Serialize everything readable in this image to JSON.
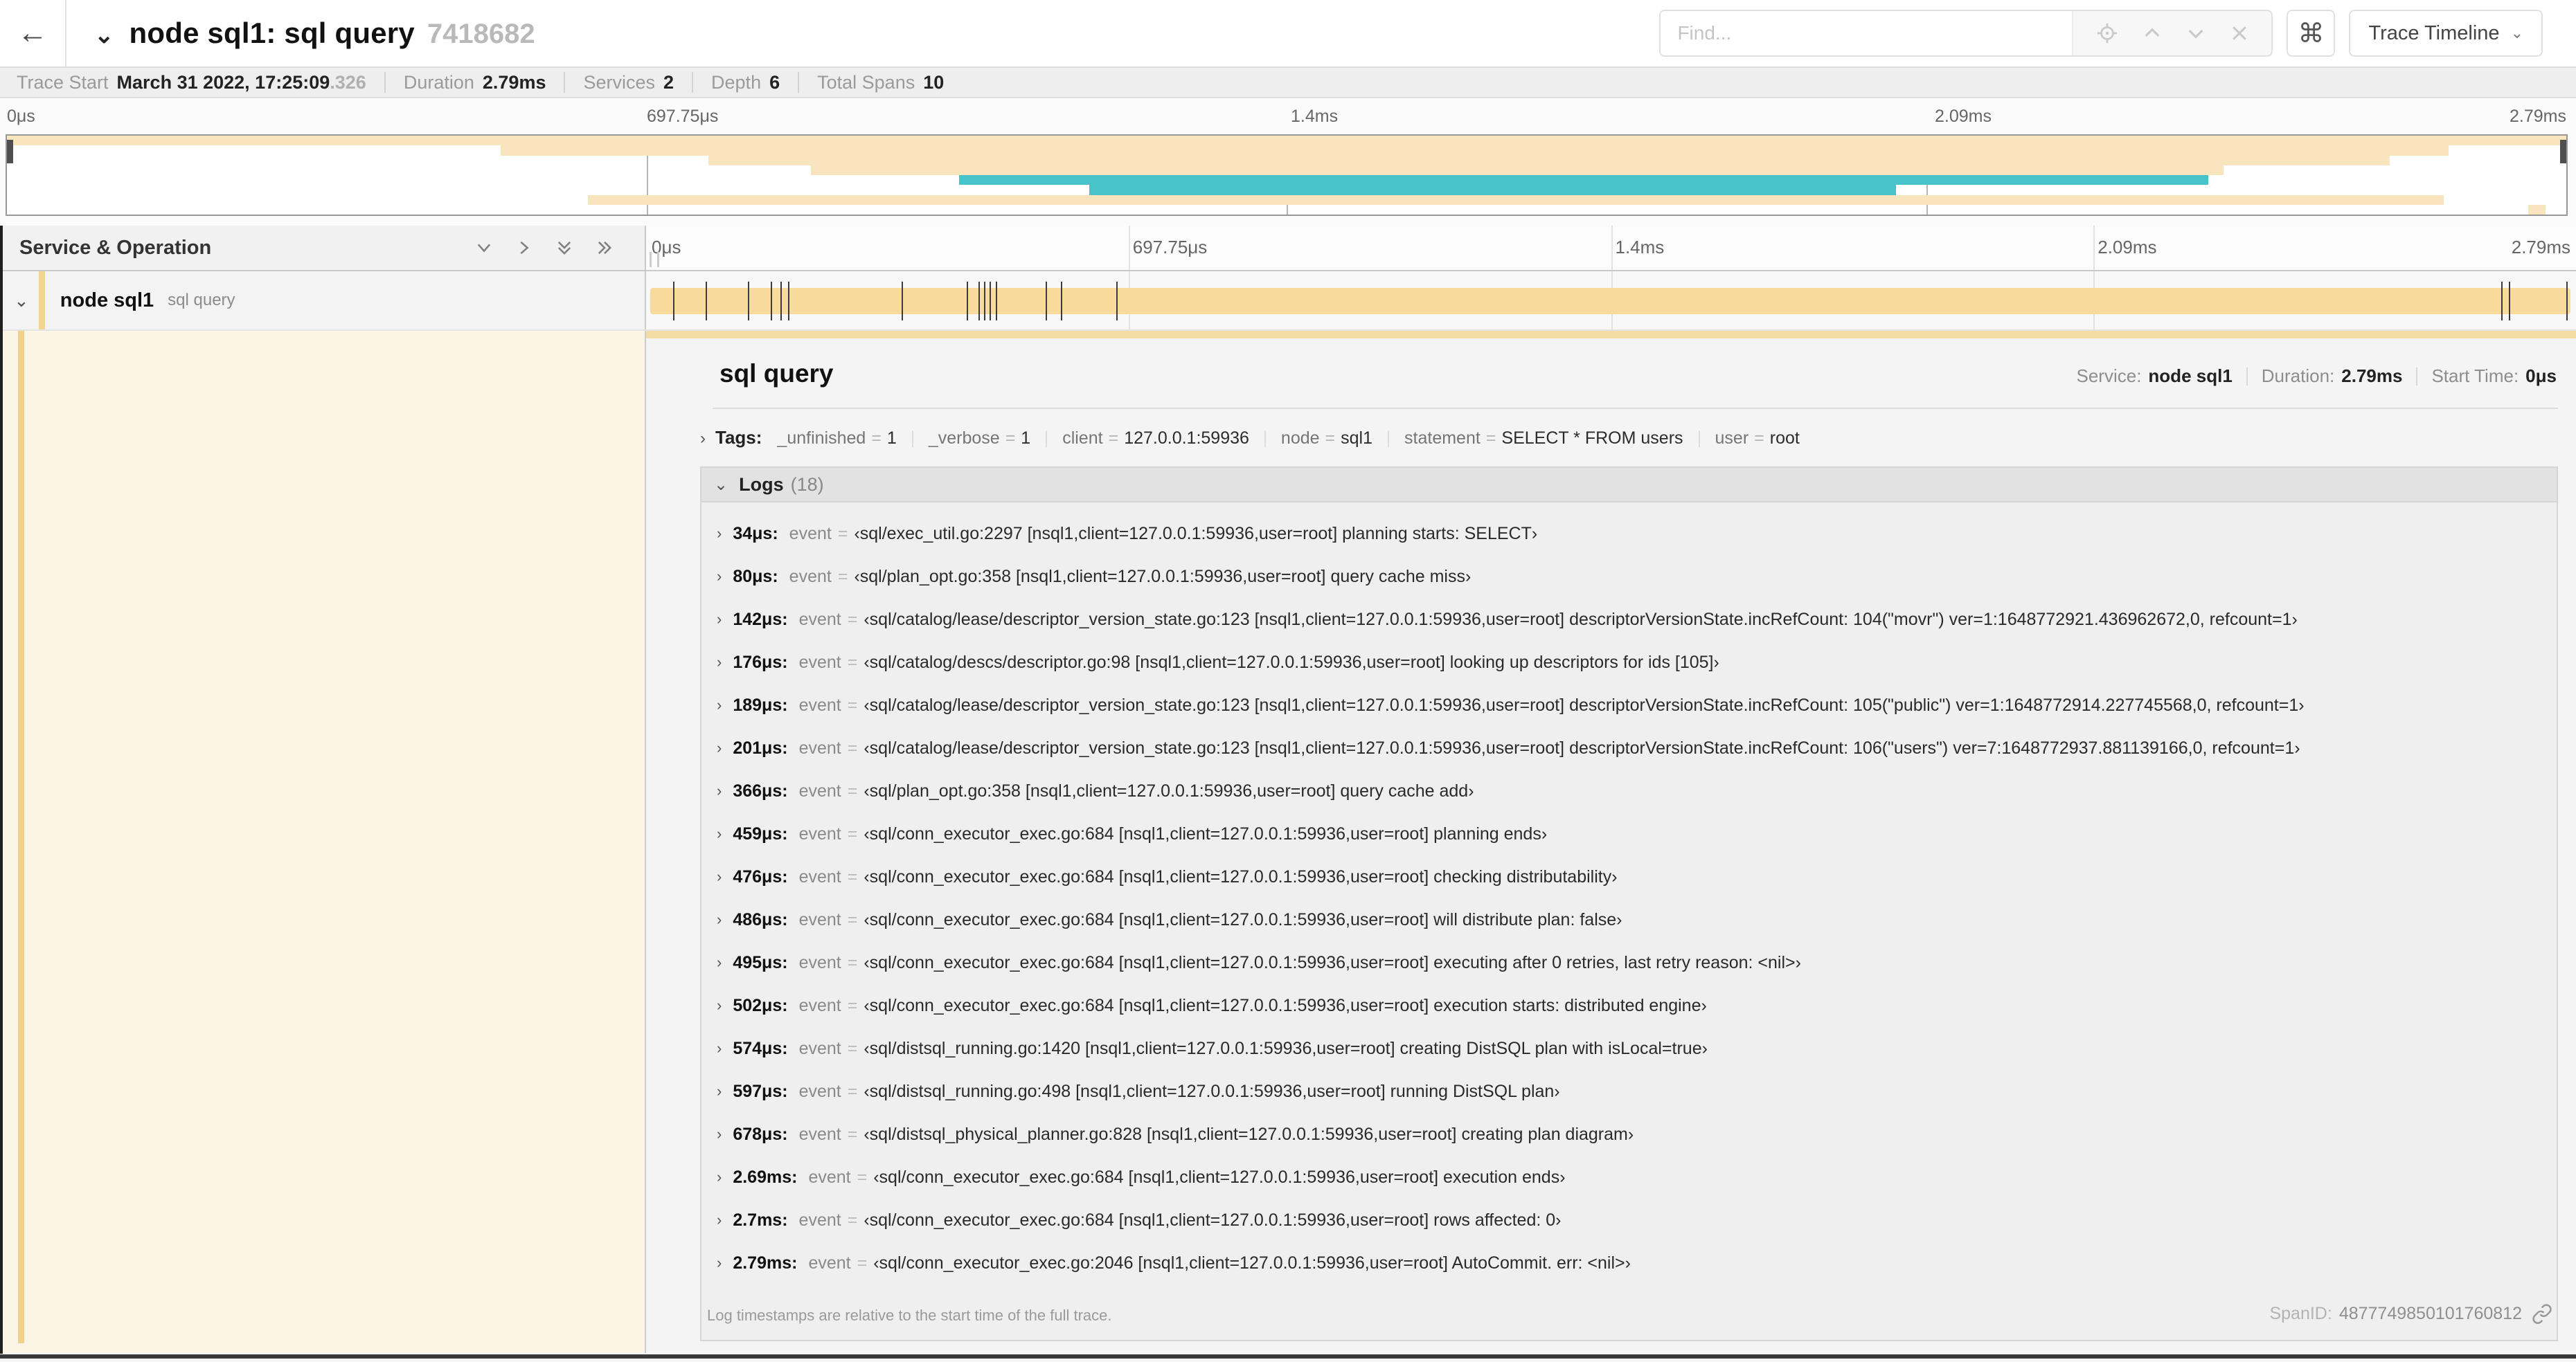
{
  "topbar": {
    "back_icon": "back-arrow",
    "collapse_icon": "chevron-down",
    "title": "node sql1: sql query",
    "trace_id": "7418682",
    "find_placeholder": "Find...",
    "kbd_button": "⌘",
    "view_select": "Trace Timeline"
  },
  "infobar": {
    "items": [
      {
        "label": "Trace Start",
        "value": "March 31 2022, 17:25:09",
        "suffix": ".326"
      },
      {
        "label": "Duration",
        "value": "2.79ms",
        "suffix": ""
      },
      {
        "label": "Services",
        "value": "2",
        "suffix": ""
      },
      {
        "label": "Depth",
        "value": "6",
        "suffix": ""
      },
      {
        "label": "Total Spans",
        "value": "10",
        "suffix": ""
      }
    ]
  },
  "minimap": {
    "tick_labels": [
      "0μs",
      "697.75μs",
      "1.4ms",
      "2.09ms",
      "2.79ms"
    ],
    "tick_pcts": [
      0,
      25,
      50,
      75,
      100
    ],
    "bars": [
      {
        "row": 0,
        "color": "tan",
        "left": 0,
        "width": 100
      },
      {
        "row": 1,
        "color": "tan",
        "left": 19.3,
        "width": 76.1
      },
      {
        "row": 2,
        "color": "tan",
        "left": 27.4,
        "width": 65.7
      },
      {
        "row": 3,
        "color": "tan",
        "left": 31.4,
        "width": 55.2
      },
      {
        "row": 4,
        "color": "teal",
        "left": 37.2,
        "width": 48.8
      },
      {
        "row": 5,
        "color": "teal",
        "left": 42.3,
        "width": 31.5
      },
      {
        "row": 6,
        "color": "tan",
        "left": 22.7,
        "width": 72.5
      },
      {
        "row": 7,
        "color": "tan",
        "left": 98.5,
        "width": 0.7
      }
    ]
  },
  "grid_header": {
    "title": "Service & Operation"
  },
  "ruler": {
    "tick_labels": [
      "0μs",
      "697.75μs",
      "1.4ms",
      "2.09ms",
      "2.79ms"
    ],
    "tick_pcts": [
      0,
      25,
      50,
      75,
      100
    ]
  },
  "span_row": {
    "service": "node sql1",
    "operation": "sql query",
    "tick_pcts": [
      1.2,
      2.9,
      5.1,
      6.3,
      6.8,
      7.2,
      13.1,
      16.5,
      17.1,
      17.4,
      17.7,
      18.0,
      20.6,
      21.4,
      24.3,
      96.4,
      96.8,
      99.8
    ]
  },
  "detail": {
    "title": "sql query",
    "meta": [
      {
        "label": "Service:",
        "value": "node sql1"
      },
      {
        "label": "Duration:",
        "value": "2.79ms"
      },
      {
        "label": "Start Time:",
        "value": "0μs"
      }
    ],
    "tags_label": "Tags:",
    "tags": [
      {
        "key": "_unfinished",
        "value": "1"
      },
      {
        "key": "_verbose",
        "value": "1"
      },
      {
        "key": "client",
        "value": "127.0.0.1:59936"
      },
      {
        "key": "node",
        "value": "sql1"
      },
      {
        "key": "statement",
        "value": "SELECT * FROM users"
      },
      {
        "key": "user",
        "value": "root"
      }
    ],
    "logs_title": "Logs",
    "logs_count": "(18)",
    "logs": [
      {
        "time": "34μs:",
        "field": "event",
        "value": "‹sql/exec_util.go:2297 [nsql1,client=127.0.0.1:59936,user=root] planning starts: SELECT›"
      },
      {
        "time": "80μs:",
        "field": "event",
        "value": "‹sql/plan_opt.go:358 [nsql1,client=127.0.0.1:59936,user=root] query cache miss›"
      },
      {
        "time": "142μs:",
        "field": "event",
        "value": "‹sql/catalog/lease/descriptor_version_state.go:123 [nsql1,client=127.0.0.1:59936,user=root] descriptorVersionState.incRefCount: 104(\"movr\") ver=1:1648772921.436962672,0, refcount=1›"
      },
      {
        "time": "176μs:",
        "field": "event",
        "value": "‹sql/catalog/descs/descriptor.go:98 [nsql1,client=127.0.0.1:59936,user=root] looking up descriptors for ids [105]›"
      },
      {
        "time": "189μs:",
        "field": "event",
        "value": "‹sql/catalog/lease/descriptor_version_state.go:123 [nsql1,client=127.0.0.1:59936,user=root] descriptorVersionState.incRefCount: 105(\"public\") ver=1:1648772914.227745568,0, refcount=1›"
      },
      {
        "time": "201μs:",
        "field": "event",
        "value": "‹sql/catalog/lease/descriptor_version_state.go:123 [nsql1,client=127.0.0.1:59936,user=root] descriptorVersionState.incRefCount: 106(\"users\") ver=7:1648772937.881139166,0, refcount=1›"
      },
      {
        "time": "366μs:",
        "field": "event",
        "value": "‹sql/plan_opt.go:358 [nsql1,client=127.0.0.1:59936,user=root] query cache add›"
      },
      {
        "time": "459μs:",
        "field": "event",
        "value": "‹sql/conn_executor_exec.go:684 [nsql1,client=127.0.0.1:59936,user=root] planning ends›"
      },
      {
        "time": "476μs:",
        "field": "event",
        "value": "‹sql/conn_executor_exec.go:684 [nsql1,client=127.0.0.1:59936,user=root] checking distributability›"
      },
      {
        "time": "486μs:",
        "field": "event",
        "value": "‹sql/conn_executor_exec.go:684 [nsql1,client=127.0.0.1:59936,user=root] will distribute plan: false›"
      },
      {
        "time": "495μs:",
        "field": "event",
        "value": "‹sql/conn_executor_exec.go:684 [nsql1,client=127.0.0.1:59936,user=root] executing after 0 retries, last retry reason: <nil>›"
      },
      {
        "time": "502μs:",
        "field": "event",
        "value": "‹sql/conn_executor_exec.go:684 [nsql1,client=127.0.0.1:59936,user=root] execution starts: distributed engine›"
      },
      {
        "time": "574μs:",
        "field": "event",
        "value": "‹sql/distsql_running.go:1420 [nsql1,client=127.0.0.1:59936,user=root] creating DistSQL plan with isLocal=true›"
      },
      {
        "time": "597μs:",
        "field": "event",
        "value": "‹sql/distsql_running.go:498 [nsql1,client=127.0.0.1:59936,user=root] running DistSQL plan›"
      },
      {
        "time": "678μs:",
        "field": "event",
        "value": "‹sql/distsql_physical_planner.go:828 [nsql1,client=127.0.0.1:59936,user=root] creating plan diagram›"
      },
      {
        "time": "2.69ms:",
        "field": "event",
        "value": "‹sql/conn_executor_exec.go:684 [nsql1,client=127.0.0.1:59936,user=root] execution ends›"
      },
      {
        "time": "2.7ms:",
        "field": "event",
        "value": "‹sql/conn_executor_exec.go:684 [nsql1,client=127.0.0.1:59936,user=root] rows affected: 0›"
      },
      {
        "time": "2.79ms:",
        "field": "event",
        "value": "‹sql/conn_executor_exec.go:2046 [nsql1,client=127.0.0.1:59936,user=root] AutoCommit. err: <nil>›"
      }
    ],
    "footnote": "Log timestamps are relative to the start time of the full trace.",
    "spanid_label": "SpanID:",
    "spanid": "4877749850101760812"
  },
  "colors": {
    "span_tan": "#f7da9c",
    "minimap_tan": "#f8e4bd",
    "minimap_teal": "#47c3c9",
    "stripe_tan": "#f1d28c",
    "detail_cream": "#fcf5e5"
  }
}
